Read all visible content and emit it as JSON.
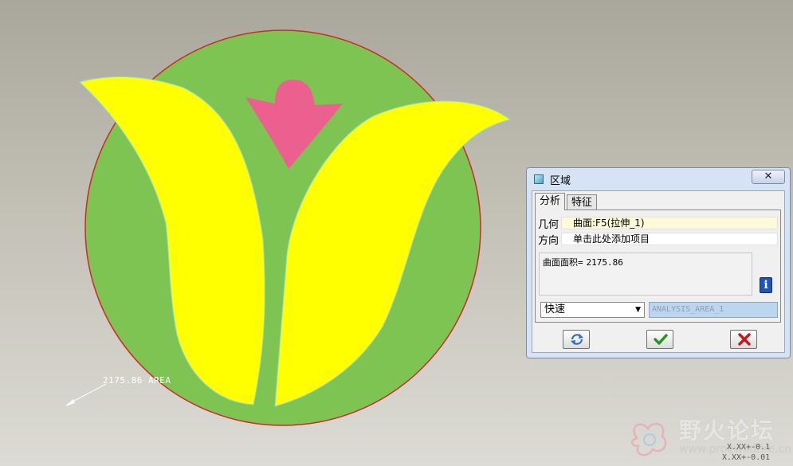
{
  "colors": {
    "circle_fill": "#7ec453",
    "circle_edge": "#d0282c",
    "petal_fill": "#ffff00",
    "bud_fill": "#ec6090",
    "ok_green": "#1e9a1e",
    "cancel_red": "#d0141b"
  },
  "model": {
    "area_annotation": "2175.86 AREA"
  },
  "dialog": {
    "title": "区域",
    "close_label": "✕",
    "tabs": [
      {
        "label": "分析",
        "active": true
      },
      {
        "label": "特征",
        "active": false
      }
    ],
    "geometry_label": "几何",
    "geometry_value": "曲面:F5(拉伸_1)",
    "direction_label": "方向",
    "direction_value": "单击此处添加项目",
    "result_label": "曲面面积=",
    "result_value": "2175.86",
    "info_icon": "i",
    "mode_value": "快速",
    "analysis_name": "ANALYSIS_AREA_1",
    "icons": [
      "dialog-window-icon",
      "repeat-icon",
      "checkmark-icon",
      "cross-icon",
      "info-icon"
    ]
  },
  "watermark": {
    "title": "野火论坛",
    "url": "www.proewildfire.cn"
  },
  "coordinates": {
    "line1": "X.XX+-0.1",
    "line2": "X.XX+-0.01"
  }
}
